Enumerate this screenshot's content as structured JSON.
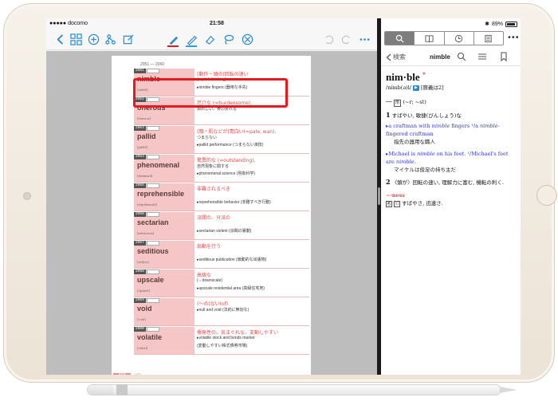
{
  "status_left": {
    "carrier": "docomo",
    "time": "21:58"
  },
  "status_right": {
    "battery": "89%",
    "battery_level": 0.89
  },
  "toolbar": {
    "pen_colors": [
      "#d81b1b",
      "#2a9fe0"
    ],
    "icons": [
      "back-icon",
      "grid-icon",
      "add-icon",
      "share-icon",
      "edit-icon",
      "pen-icon",
      "highlighter-icon",
      "eraser-icon",
      "lasso-icon",
      "close-circle-icon",
      "undo-icon",
      "redo-icon",
      "more-icon"
    ]
  },
  "book": {
    "page_range": "2051 — 2060",
    "page_number": "450",
    "entries": [
      {
        "num": "2051",
        "word": "nimble",
        "ipa": "[nimbl]",
        "def1": "(動作・頭の)回転の速い",
        "def2": "(=quick-thinking)",
        "ex": "▸nimble fingers (器用な手先)"
      },
      {
        "num": "2052",
        "word": "onerous",
        "ipa": "[óunərəs]",
        "def1": "厄介な (=burdensome),",
        "def2": "煩わしい、骨の折れる",
        "ex": ""
      },
      {
        "num": "2053",
        "word": "pallid",
        "ipa": "[pǽlid]",
        "def1": "(顔・肌などが)青白い(=pale, wan),",
        "def2": "つまらない",
        "ex": "▸pallid performance (つまらない演技)"
      },
      {
        "num": "2054",
        "word": "phenomenal",
        "ipa": "[finάmənl]",
        "def1": "驚異的な (=outstanding),",
        "def2": "自然現象に関する",
        "ex": "▸phenomenal science (現象科学)"
      },
      {
        "num": "2055",
        "word": "reprehensible",
        "ipa": "[rèprihénsəbl]",
        "def1": "非難されるべき",
        "def2": "",
        "ex": "▸reprehensible behavior (非難すべき行動)"
      },
      {
        "num": "2056",
        "word": "sectarian",
        "ipa": "[sektéəriən]",
        "def1": "派閥の、分派の",
        "def2": "",
        "ex": "▸sectarian violent (派閥の暴動)"
      },
      {
        "num": "2057",
        "word": "seditious",
        "ipa": "[sidíʃəs]",
        "def1": "扇動を行う",
        "def2": "",
        "ex": "▸seditious publication (扇動的な出版物)"
      },
      {
        "num": "2058",
        "word": "upscale",
        "ipa": "[ʌ́pskeil]",
        "def1": "高級な",
        "def2": "(⇔downscale)",
        "ex": "▸upscale residential area (高級住宅地)"
      },
      {
        "num": "2059",
        "word": "void",
        "ipa": "[vɔid]",
        "def1": "(～の)ない(of)",
        "def2": "▸null and void (法的に無効な)",
        "ex": ""
      },
      {
        "num": "2060",
        "word": "volatile",
        "ipa": "[vάlətl]",
        "def1": "揮発性の、気まぐれな、変動しやすい",
        "def2": "▸volatile stock and bonds market",
        "ex": "(変動しやすい株式債券市場)"
      }
    ]
  },
  "dictionary": {
    "back_label": "検索",
    "nav_word": "nimble",
    "headword": "nim·ble",
    "star": "*",
    "pron": "/nímb(ə)l/",
    "audio": "▶",
    "grade": "[原義は2]",
    "pos_label": "形",
    "inflect": "(~r; ~st)",
    "sense1_num": "1",
    "sense1_def": "すばやい, 敏捷(びんしょう)な",
    "ex1_pre": "▸a craftman with ",
    "ex1_it": "nimble",
    "ex1_post": " fingers ",
    "ex1_alt_pre": "¹/a ",
    "ex1_alt_it": "nimble",
    "ex1_alt_post": "-fingered craftman",
    "ex1_jp": "指先の器用な職人",
    "ex2_pre": "▸Michael is ",
    "ex2_it": "nimble",
    "ex2_post": " on his feet. ",
    "ex2_alt_pre": "¹/Michael's feet are ",
    "ex2_alt_it": "nimble",
    "ex2_alt_post": ".",
    "ex2_jp": "マイケルは俊足の持ち主だ",
    "sense2_num": "2",
    "sense2_def": "〈頭が〉回転の速い, 理解力に富む, 機転の利く.",
    "deriv": "~·ness",
    "deriv_label1": "名",
    "deriv_label2": "U",
    "deriv_def": "すばやさ, 迅速さ."
  }
}
